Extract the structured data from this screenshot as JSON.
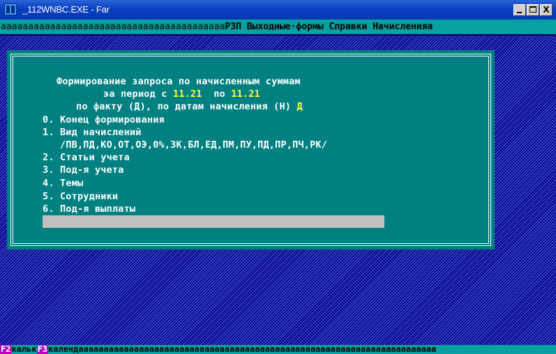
{
  "window": {
    "title": "_112WNBC.EXE - Far",
    "minimize_label": "",
    "close_label": "X"
  },
  "menubar": {
    "fill_left": "ааааааааааааааааааааааааааааааааааааааааа",
    "items": "РЗП Выходные·формы Справки Начисленияа"
  },
  "dialog": {
    "title": "Формирование запроса по начисленным суммам",
    "period_prefix": "эа период с ",
    "period_from": "11.21",
    "period_middle": "  по ",
    "period_to": "11.21",
    "mode_prompt": "по факту (Д), по датам начисления (Н) ",
    "mode_value": "Д",
    "options": [
      "0. Конец формирования",
      "1. Вид начислений",
      "   /ПВ,ПД,КО,ОТ,ОЭ,0%,ЗК,БЛ,ЕД,ПМ,ПУ,ПД,ПР,ПЧ,РК/",
      "2. Статьи учета",
      "3. Под-я учета",
      "4. Темы",
      "5. Сотрудники",
      "6. Под-я выплаты"
    ],
    "input_value": ""
  },
  "keybar": {
    "f2_key": "F2",
    "f2_label": "кальк",
    "f3_key": "F3",
    "f3_label": "календааааааааааааааааааааааааааааааааааааааааааааааааааааааааааааааааааааааа"
  },
  "colors": {
    "console_bg": "#000088",
    "menubar_bg": "#08a0a0",
    "dialog_bg": "#008080",
    "highlight": "#ffff40",
    "fkey_bg": "#c000c0"
  }
}
